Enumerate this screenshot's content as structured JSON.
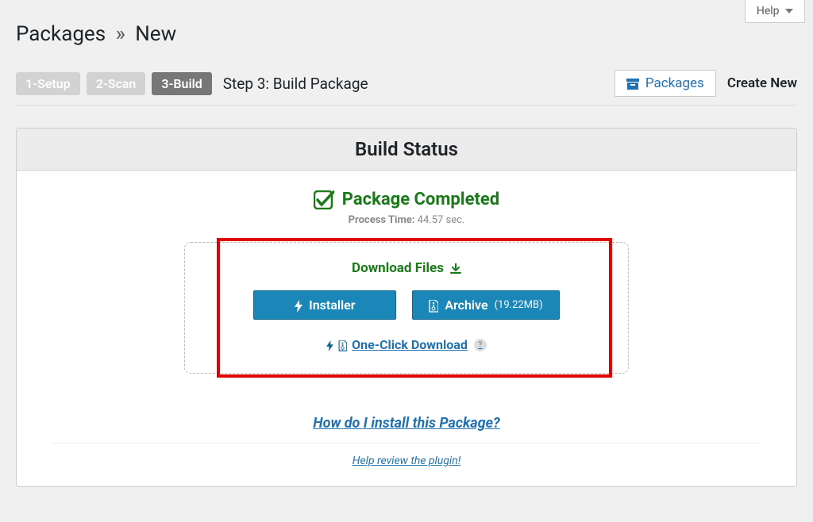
{
  "help_tab": "Help",
  "breadcrumb": {
    "root": "Packages",
    "current": "New"
  },
  "steps": {
    "s1": "1-Setup",
    "s2": "2-Scan",
    "s3": "3-Build",
    "title": "Step 3: Build Package"
  },
  "actions": {
    "packages": "Packages",
    "create_new": "Create New"
  },
  "panel_title": "Build Status",
  "completed": {
    "label": "Package Completed",
    "process_label": "Process Time:",
    "process_value": "44.57 sec."
  },
  "download": {
    "title": "Download Files",
    "installer": "Installer",
    "archive": "Archive",
    "archive_size": "(19.22MB)",
    "one_click": "One-Click Download"
  },
  "links": {
    "how_install": "How do I install this Package?",
    "review": "Help review the plugin!"
  }
}
